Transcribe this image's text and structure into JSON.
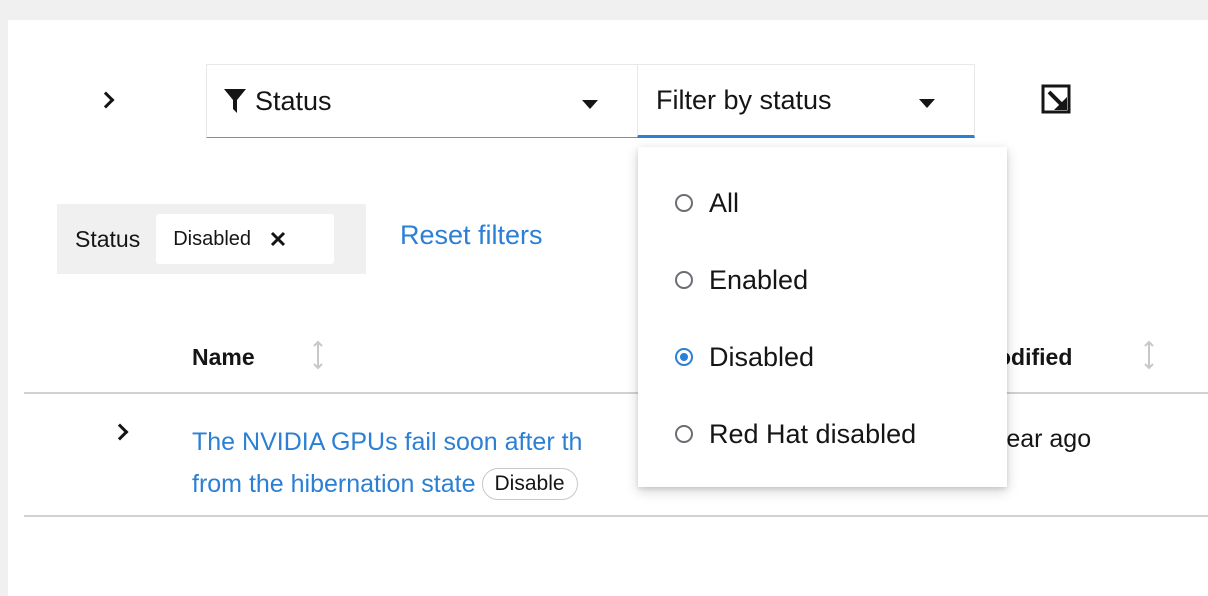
{
  "toolbar": {
    "attribute_label": "Status",
    "status_placeholder": "Filter by status",
    "reset_label": "Reset filters"
  },
  "chip_group": {
    "category": "Status",
    "chips": [
      {
        "label": "Disabled"
      }
    ]
  },
  "table": {
    "columns": {
      "name": "Name",
      "modified": "odified"
    },
    "rows": [
      {
        "title_line1": "The NVIDIA GPUs fail soon after th",
        "title_line2": "from the hibernation state",
        "badge": "Disable",
        "modified": "rear ago"
      }
    ]
  },
  "dropdown": {
    "options": [
      {
        "label": "All",
        "checked": false
      },
      {
        "label": "Enabled",
        "checked": false
      },
      {
        "label": "Disabled",
        "checked": true
      },
      {
        "label": "Red Hat disabled",
        "checked": false
      }
    ]
  },
  "colors": {
    "accent": "#2b7fd4",
    "text": "#151515",
    "border": "#d2d2d2"
  }
}
